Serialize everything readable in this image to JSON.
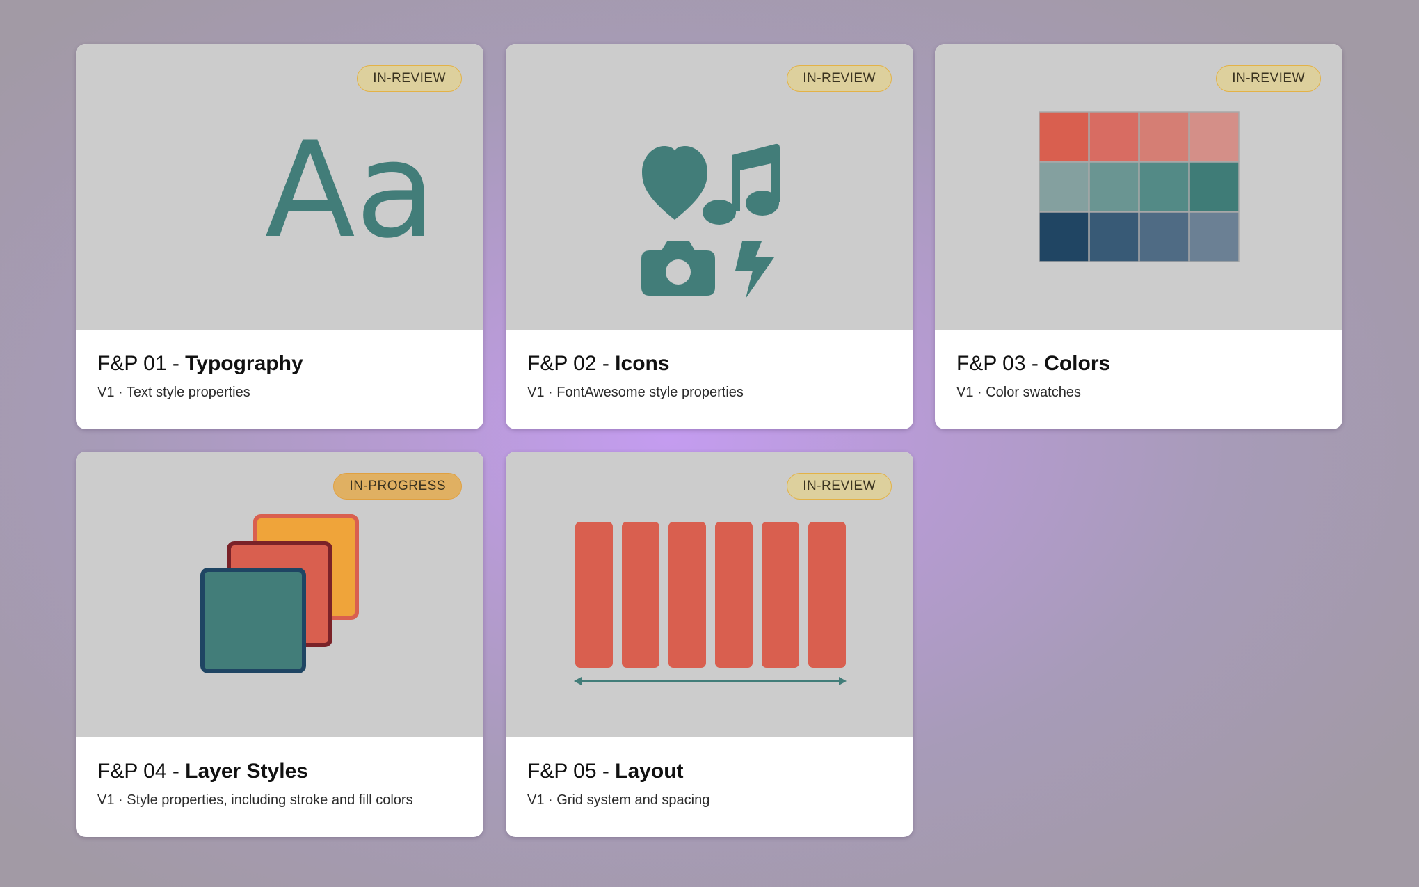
{
  "colors": {
    "teal": "#427d79",
    "coral": "#d95f4f",
    "navy": "#1f4563",
    "orange": "#efa43a",
    "dark_red": "#7a2228",
    "badge_review": "#ddd09d",
    "badge_progress": "#e0b062"
  },
  "cards": [
    {
      "badge": "IN-REVIEW",
      "title_prefix": "F&P 01 - ",
      "title_bold": "Typography",
      "subtitle": "V1 · Text style properties",
      "thumbnail_text": "Aa"
    },
    {
      "badge": "IN-REVIEW",
      "title_prefix": "F&P 02 - ",
      "title_bold": "Icons",
      "subtitle": "V1 · FontAwesome style properties",
      "icons": [
        "heart-icon",
        "music-icon",
        "camera-icon",
        "bolt-icon"
      ]
    },
    {
      "badge": "IN-REVIEW",
      "title_prefix": "F&P 03 - ",
      "title_bold": "Colors",
      "subtitle": "V1 · Color swatches",
      "swatches": [
        [
          "#d95f4f",
          "#d86c62",
          "#d57e74",
          "#d48f88"
        ],
        [
          "#84a09f",
          "#6a9592",
          "#538a86",
          "#3f7c77"
        ],
        [
          "#204563",
          "#385a76",
          "#4f6b84",
          "#6b8094"
        ]
      ]
    },
    {
      "badge": "IN-PROGRESS",
      "title_prefix": "F&P 04 - ",
      "title_bold": "Layer Styles",
      "subtitle": "V1 · Style properties, including stroke and fill colors"
    },
    {
      "badge": "IN-REVIEW",
      "title_prefix": "F&P 05 - ",
      "title_bold": "Layout",
      "subtitle": "V1 · Grid system and spacing",
      "columns": 6
    }
  ]
}
